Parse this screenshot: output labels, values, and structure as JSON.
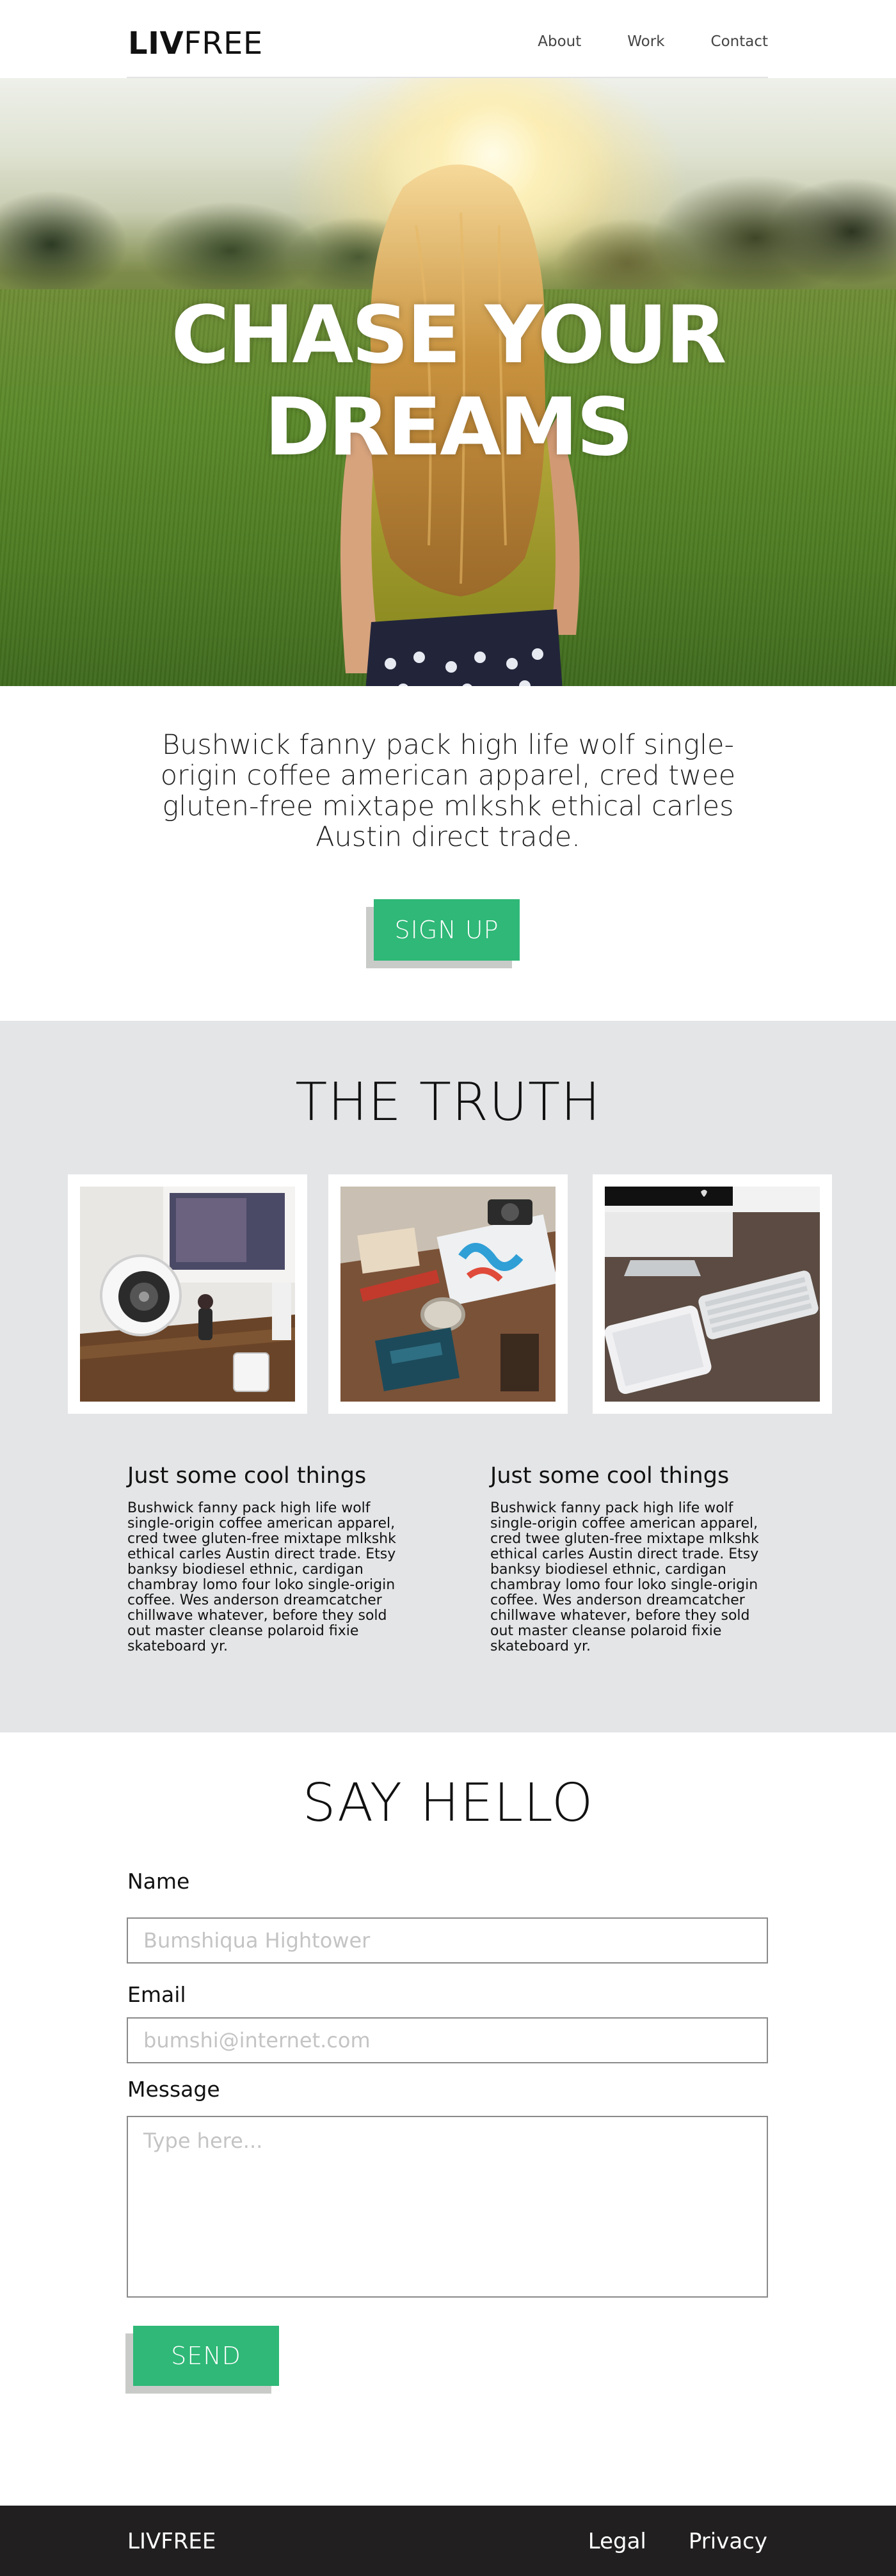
{
  "header": {
    "logo_bold": "LIV",
    "logo_light": "FREE",
    "nav": [
      {
        "label": "About"
      },
      {
        "label": "Work"
      },
      {
        "label": "Contact"
      }
    ]
  },
  "hero": {
    "title_line1": "CHASE YOUR",
    "title_line2": "DREAMS"
  },
  "intro": {
    "text": "Bushwick fanny pack high life wolf single-origin coffee american apparel, cred twee gluten-free mixtape mlkshk ethical carles Austin direct trade.",
    "button_label": "SIGN UP"
  },
  "truth": {
    "title": "THE TRUTH",
    "columns": [
      {
        "heading": "Just some cool things",
        "body": "Bushwick fanny pack high life wolf single-origin coffee american apparel, cred twee gluten-free mixtape mlkshk ethical carles Austin direct trade. Etsy banksy biodiesel ethnic, cardigan chambray lomo four loko single-origin coffee. Wes anderson dreamcatcher chillwave whatever, before they sold out master cleanse polaroid fixie skateboard yr."
      },
      {
        "heading": "Just some cool things",
        "body": "Bushwick fanny pack high life wolf single-origin coffee american apparel, cred twee gluten-free mixtape mlkshk ethical carles Austin direct trade. Etsy banksy biodiesel ethnic, cardigan chambray lomo four loko single-origin coffee. Wes anderson dreamcatcher chillwave whatever, before they sold out master cleanse polaroid fixie skateboard yr."
      }
    ]
  },
  "contact": {
    "title": "SAY HELLO",
    "name_label": "Name",
    "name_placeholder": "Bumshiqua Hightower",
    "email_label": "Email",
    "email_placeholder": "bumshi@internet.com",
    "message_label": "Message",
    "message_placeholder": "Type here...",
    "send_label": "SEND"
  },
  "footer": {
    "brand": "LIVFREE",
    "links": [
      {
        "label": "Legal"
      },
      {
        "label": "Privacy"
      }
    ]
  },
  "colors": {
    "accent": "#2fb877",
    "section_bg": "#e4e5e7",
    "footer_bg": "#211f20"
  }
}
